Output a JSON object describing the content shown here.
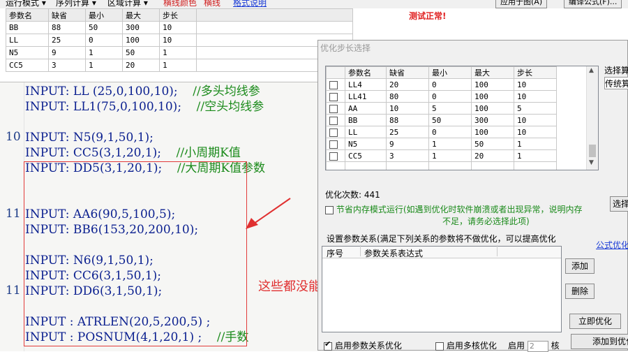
{
  "toolbar": {
    "menu": [
      "运行模式 ▾",
      "序列计算 ▾",
      "区域计算 ▾"
    ],
    "red_items": [
      "横线颜色",
      "横线"
    ],
    "link": "格式说明",
    "buttons": [
      "应用于图(A)",
      "编译公式(F)..."
    ]
  },
  "status": {
    "test_ok": "测试正常!"
  },
  "param_table": {
    "headers": [
      "参数名",
      "缺省",
      "最小",
      "最大",
      "步长"
    ],
    "rows": [
      [
        "BB",
        "88",
        "50",
        "300",
        "10"
      ],
      [
        "LL",
        "25",
        "0",
        "100",
        "10"
      ],
      [
        "N5",
        "9",
        "1",
        "50",
        "1"
      ],
      [
        "CC5",
        "3",
        "1",
        "20",
        "1"
      ]
    ]
  },
  "editor": {
    "line_numbers": [
      "10",
      "11",
      "11"
    ],
    "lines": [
      {
        "code": "INPUT: LL (25,0,100,10);",
        "comment": "//多头均线参"
      },
      {
        "code": "INPUT: LL1(75,0,100,10);",
        "comment": "//空头均线参"
      },
      {
        "code": "",
        "comment": ""
      },
      {
        "code": "INPUT: N5(9,1,50,1);",
        "comment": ""
      },
      {
        "code": "INPUT: CC5(3,1,20,1);",
        "comment": "//小周期K值"
      },
      {
        "code": "INPUT: DD5(3,1,20,1);",
        "comment": "//大周期K值参数"
      },
      {
        "code": "",
        "comment": ""
      },
      {
        "code": "",
        "comment": ""
      },
      {
        "code": "INPUT: AA6(90,5,100,5);",
        "comment": ""
      },
      {
        "code": "INPUT: BB6(153,20,200,10);",
        "comment": ""
      },
      {
        "code": "",
        "comment": ""
      },
      {
        "code": "INPUT: N6(9,1,50,1);",
        "comment": ""
      },
      {
        "code": "INPUT: CC6(3,1,50,1);",
        "comment": ""
      },
      {
        "code": "INPUT: DD6(3,1,50,1);",
        "comment": ""
      },
      {
        "code": "",
        "comment": ""
      },
      {
        "code": "INPUT : ATRLEN(20,5,200,5) ;",
        "comment": ""
      },
      {
        "code": "INPUT : POSNUM(4,1,20,1) ;",
        "comment": "//手数"
      }
    ]
  },
  "annotation": "这些都没能自动输入",
  "dialog": {
    "title": "优化步长选择",
    "headers": [
      "",
      "参数名",
      "缺省",
      "最小",
      "最大",
      "步长"
    ],
    "rows": [
      [
        "LL4",
        "20",
        "0",
        "100",
        "10"
      ],
      [
        "LL41",
        "80",
        "0",
        "100",
        "10"
      ],
      [
        "AA",
        "10",
        "5",
        "100",
        "5"
      ],
      [
        "BB",
        "88",
        "50",
        "300",
        "10"
      ],
      [
        "LL",
        "25",
        "0",
        "100",
        "10"
      ],
      [
        "N5",
        "9",
        "1",
        "50",
        "1"
      ],
      [
        "CC5",
        "3",
        "1",
        "20",
        "1"
      ]
    ],
    "select_algo_label": "选择算",
    "algo_value": "传统算",
    "opt_count": "优化次数: 441",
    "save_mem_label": "节省内存模式运行(如遇到优化时软件崩溃或者出现异常，说明内存",
    "save_mem_label2": "不足，请务必选择此项)",
    "select_btn": "选择",
    "relation_label": "设置参数关系(满足下列关系的参数将不做优化，可以提高优化",
    "formula_link": "公式优化",
    "rel_headers": [
      "序号",
      "参数关系表达式"
    ],
    "add_btn": "添加",
    "delete_btn": "删除",
    "optimize_btn": "立即优化",
    "enable_relation": "启用参数关系优化",
    "multicore_label": "启用多核优化",
    "enable_label": "启用",
    "core_count": "2",
    "core_unit": "核",
    "add_to_btn": "添加到优化"
  }
}
